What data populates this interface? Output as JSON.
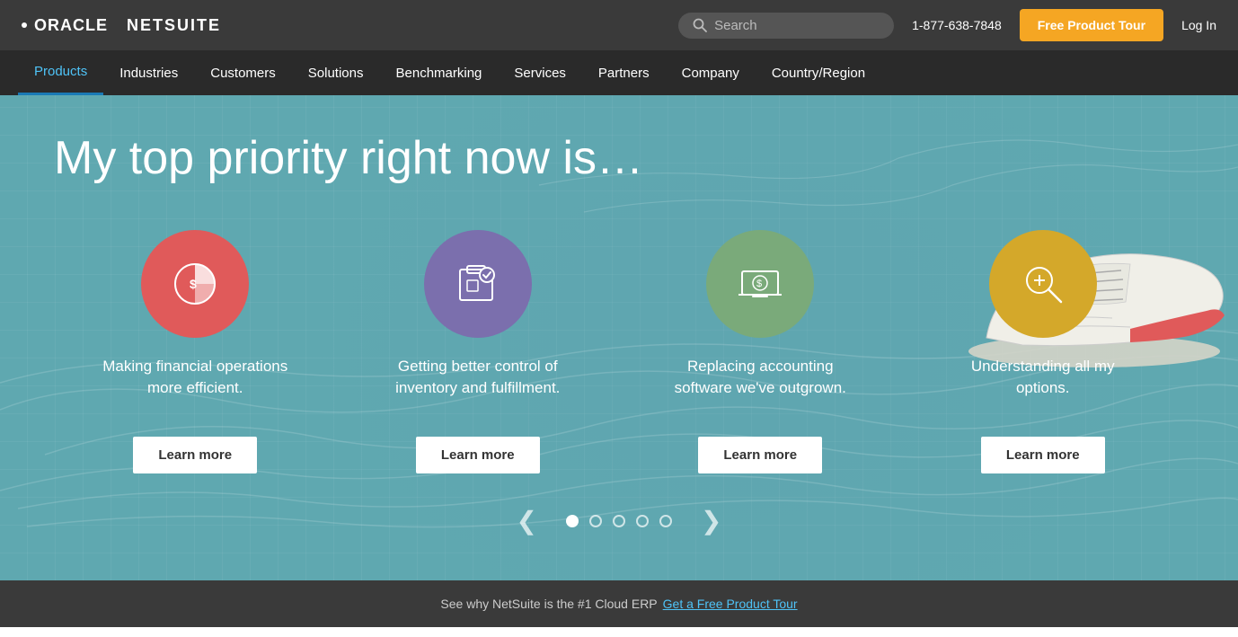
{
  "topbar": {
    "logo_oracle": "ORACLE",
    "logo_netsuite": "NETSUITE",
    "search_placeholder": "Search",
    "phone": "1-877-638-7848",
    "free_tour_label": "Free Product Tour",
    "login_label": "Log In"
  },
  "nav": {
    "items": [
      {
        "label": "Products"
      },
      {
        "label": "Industries"
      },
      {
        "label": "Customers"
      },
      {
        "label": "Solutions"
      },
      {
        "label": "Benchmarking"
      },
      {
        "label": "Services"
      },
      {
        "label": "Partners"
      },
      {
        "label": "Company"
      },
      {
        "label": "Country/Region"
      }
    ]
  },
  "hero": {
    "title": "My top priority right now is…",
    "cards": [
      {
        "icon_color": "pink",
        "icon_name": "finance-icon",
        "text": "Making financial operations more efficient.",
        "btn_label": "Learn more"
      },
      {
        "icon_color": "purple",
        "icon_name": "inventory-icon",
        "text": "Getting better control of inventory and fulfillment.",
        "btn_label": "Learn more"
      },
      {
        "icon_color": "teal-green",
        "icon_name": "accounting-icon",
        "text": "Replacing accounting software we've outgrown.",
        "btn_label": "Learn more"
      },
      {
        "icon_color": "yellow",
        "icon_name": "options-icon",
        "text": "Understanding all my options.",
        "btn_label": "Learn more"
      }
    ],
    "carousel_dots": 5,
    "prev_arrow": "❮",
    "next_arrow": "❯"
  },
  "bottombar": {
    "text": "See why NetSuite is the #1 Cloud ERP",
    "link_label": "Get a Free Product Tour"
  }
}
